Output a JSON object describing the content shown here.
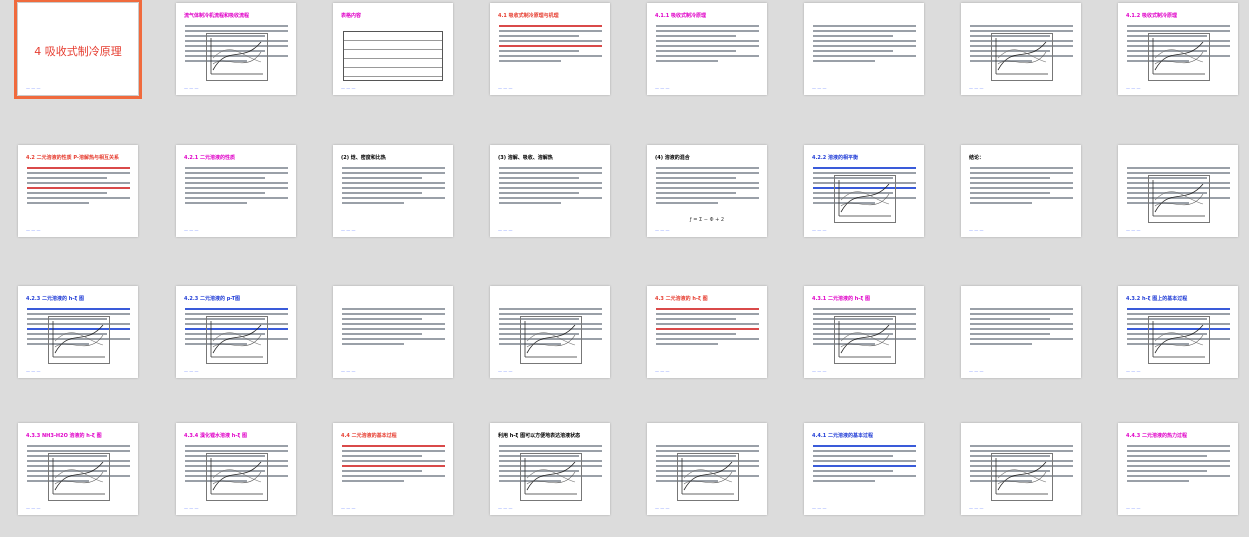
{
  "slides": [
    {
      "id": 1,
      "title": "4 吸收式制冷原理",
      "style": "big",
      "selected": true
    },
    {
      "id": 2,
      "title": "流气体制冷机流程和吸收流程",
      "style": "mag"
    },
    {
      "id": 3,
      "title": "表格内容",
      "style": "mag"
    },
    {
      "id": 4,
      "title": "4.1 吸收式制冷原理与机理",
      "style": "red"
    },
    {
      "id": 5,
      "title": "4.1.1 吸收式制冷原理",
      "style": "mag"
    },
    {
      "id": 6,
      "title": "",
      "style": "plain"
    },
    {
      "id": 7,
      "title": "",
      "style": "plain"
    },
    {
      "id": 8,
      "title": "4.1.2 吸收式制冷原理",
      "style": "mag"
    },
    {
      "id": 9,
      "title": "4.2 二元溶液的性质 P-溶解热与相互关系",
      "style": "red"
    },
    {
      "id": 10,
      "title": "4.2.1 二元溶液的性质",
      "style": "mag"
    },
    {
      "id": 11,
      "title": "(2) 焓、密度和比热",
      "style": "plain"
    },
    {
      "id": 12,
      "title": "(3) 溶解、吸收、溶解热",
      "style": "plain"
    },
    {
      "id": 13,
      "title": "(4) 溶液的混合",
      "style": "plain"
    },
    {
      "id": 14,
      "title": "4.2.2 溶液的相平衡",
      "style": "blue"
    },
    {
      "id": 15,
      "title": "结论：",
      "style": "plain"
    },
    {
      "id": 16,
      "title": "",
      "style": "plain"
    },
    {
      "id": 17,
      "title": "4.2.3 二元溶液的 h-ξ 图",
      "style": "blue"
    },
    {
      "id": 18,
      "title": "4.2.3 二元溶液的 p-T图",
      "style": "blue"
    },
    {
      "id": 19,
      "title": "",
      "style": "plain"
    },
    {
      "id": 20,
      "title": "",
      "style": "plain"
    },
    {
      "id": 21,
      "title": "4.3 二元溶液的 h-ξ 图",
      "style": "red"
    },
    {
      "id": 22,
      "title": "4.3.1 二元溶液的 h-ξ 图",
      "style": "mag"
    },
    {
      "id": 23,
      "title": "",
      "style": "plain"
    },
    {
      "id": 24,
      "title": "4.3.2 h-ξ 图上的基本过程",
      "style": "blue"
    },
    {
      "id": 25,
      "title": "4.3.3 NH3-H2O 溶液的 h-ξ 图",
      "style": "mag"
    },
    {
      "id": 26,
      "title": "4.3.4 溴化锂水溶液 h-ξ 图",
      "style": "mag"
    },
    {
      "id": 27,
      "title": "4.4 二元溶液的基本过程",
      "style": "red"
    },
    {
      "id": 28,
      "title": "利用 h-ξ 图可以方便地表达溶液状态",
      "style": "plain"
    },
    {
      "id": 29,
      "title": "",
      "style": "plain"
    },
    {
      "id": 30,
      "title": "4.4.1 二元溶液的基本过程",
      "style": "blue"
    },
    {
      "id": 31,
      "title": "",
      "style": "plain"
    },
    {
      "id": 32,
      "title": "4.4.3 二元溶液的热力过程",
      "style": "mag"
    }
  ],
  "formula_13": "ƒ = Σ − Φ + 2",
  "formula_28": "h = f(ξ)"
}
